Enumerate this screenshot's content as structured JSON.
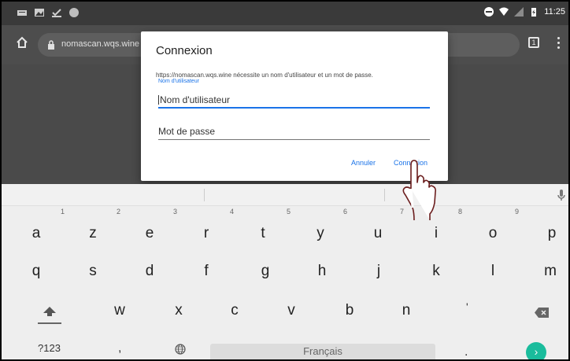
{
  "status_bar": {
    "time": "11:25"
  },
  "browser": {
    "url": "nomascan.wqs.wine",
    "tab_count": "1"
  },
  "dialog": {
    "title": "Connexion",
    "message": "https://nomascan.wqs.wine nécessite un nom d'utilisateur et un mot de passe.",
    "username_label": "Nom d'utilisateur",
    "username_placeholder": "Nom d'utilisateur",
    "password_placeholder": "Mot de passe",
    "cancel_label": "Annuler",
    "ok_label": "Connexion"
  },
  "keyboard": {
    "row1": [
      {
        "key": "a",
        "hint": "1"
      },
      {
        "key": "z",
        "hint": "2"
      },
      {
        "key": "e",
        "hint": "3"
      },
      {
        "key": "r",
        "hint": "4"
      },
      {
        "key": "t",
        "hint": "5"
      },
      {
        "key": "y",
        "hint": "6"
      },
      {
        "key": "u",
        "hint": "7"
      },
      {
        "key": "i",
        "hint": "8"
      },
      {
        "key": "o",
        "hint": "9"
      },
      {
        "key": "p",
        "hint": ""
      }
    ],
    "row2": [
      "q",
      "s",
      "d",
      "f",
      "g",
      "h",
      "j",
      "k",
      "l",
      "m"
    ],
    "row3": [
      "w",
      "x",
      "c",
      "v",
      "b",
      "n"
    ],
    "apostrophe": "'",
    "symbols_label": "?123",
    "comma": ",",
    "space_label": "Français",
    "period": "."
  },
  "colors": {
    "accent": "#1a73e8",
    "enter": "#1abc9c",
    "scrim": "#4a4a4a"
  }
}
